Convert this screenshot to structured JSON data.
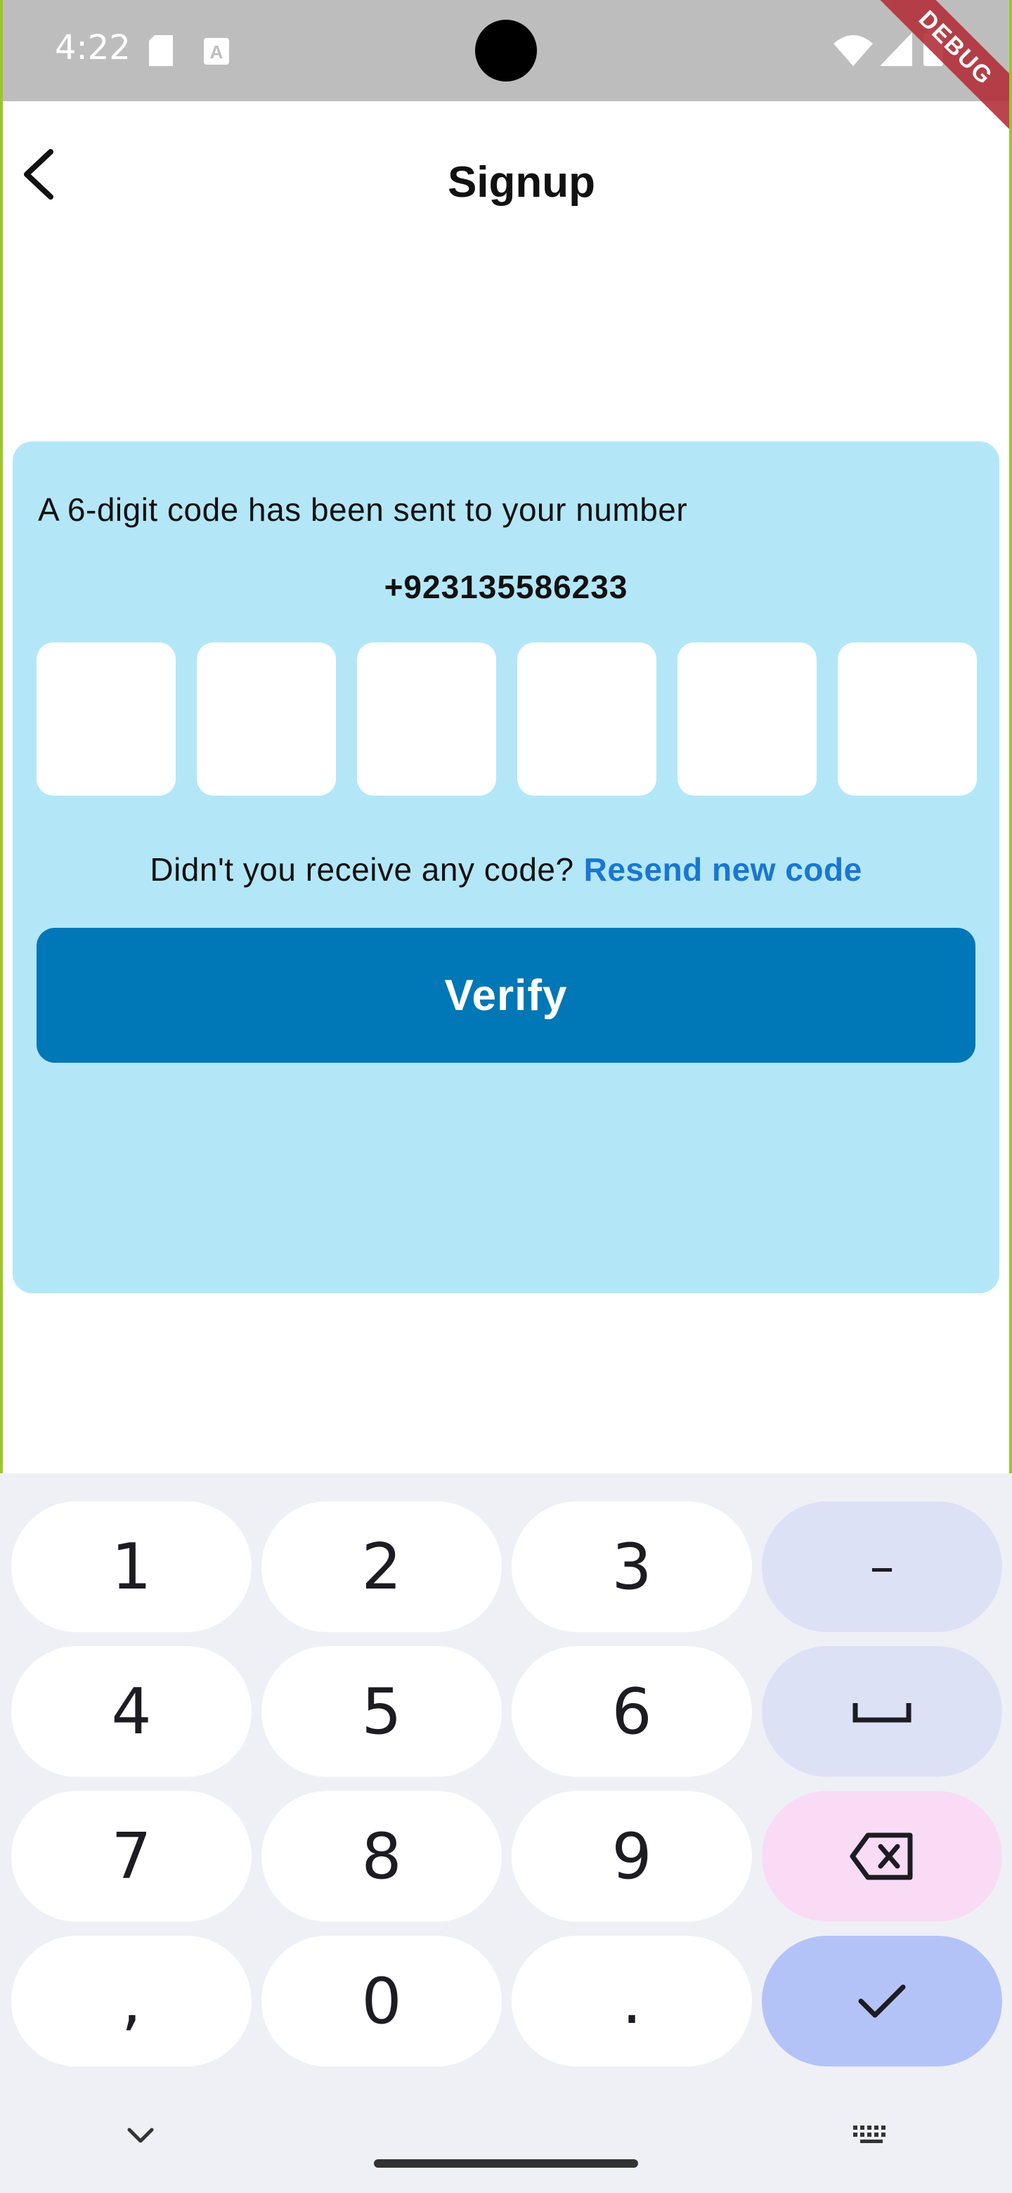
{
  "status_bar": {
    "time": "4:22",
    "icons": [
      "sd-card-icon",
      "text-a-icon",
      "wifi-icon",
      "signal-icon",
      "battery-icon"
    ],
    "debug_label": "DEBUG"
  },
  "app_bar": {
    "title": "Signup",
    "back_icon": "chevron-left-icon"
  },
  "otp": {
    "info": "A 6-digit code has been sent to your number",
    "phone": "+923135586233",
    "digits": [
      "",
      "",
      "",
      "",
      "",
      ""
    ],
    "resend_prompt": "Didn't you receive any code?",
    "resend_link": "Resend new code",
    "verify_label": "Verify"
  },
  "keyboard": {
    "rows": [
      [
        "1",
        "2",
        "3",
        "–"
      ],
      [
        "4",
        "5",
        "6",
        "space"
      ],
      [
        "7",
        "8",
        "9",
        "backspace"
      ],
      [
        ",",
        "0",
        ".",
        "done"
      ]
    ]
  },
  "colors": {
    "card_bg": "#b3e7f8",
    "verify_bg": "#0077b6",
    "link": "#1976d2",
    "status_bar": "#bdbdbd"
  }
}
